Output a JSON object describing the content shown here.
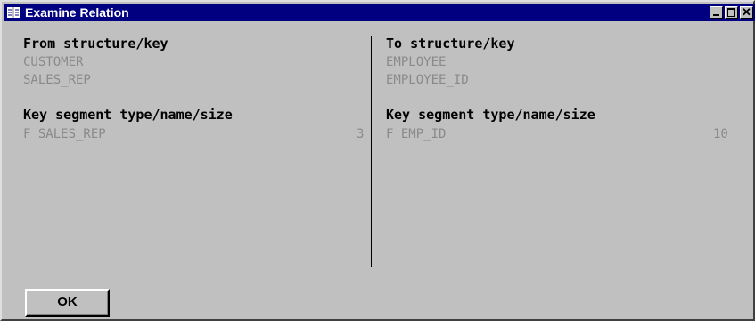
{
  "window": {
    "title": "Examine Relation"
  },
  "from": {
    "structure_heading": "From structure/key",
    "structure": "CUSTOMER",
    "key": "SALES_REP",
    "segment_heading": "Key segment type/name/size",
    "segment_type_name": "F SALES_REP",
    "segment_size": "3"
  },
  "to": {
    "structure_heading": "To structure/key",
    "structure": "EMPLOYEE",
    "key": "EMPLOYEE_ID",
    "segment_heading": "Key segment type/name/size",
    "segment_type_name": "F EMP_ID",
    "segment_size": "10"
  },
  "buttons": {
    "ok": "OK"
  },
  "icons": {
    "window": "book-icon",
    "minimize": "minimize-icon",
    "maximize": "maximize-icon",
    "close": "close-icon"
  }
}
